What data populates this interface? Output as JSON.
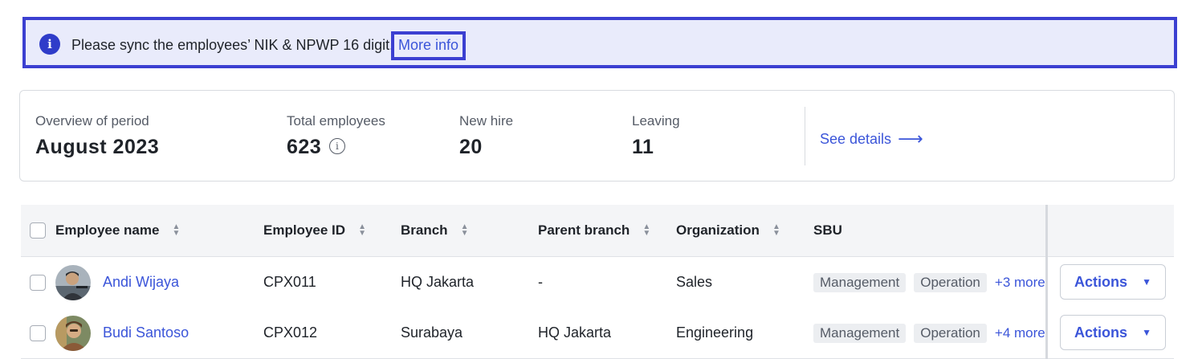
{
  "banner": {
    "icon": "info-icon",
    "message": "Please sync the employees’ NIK & NPWP 16 digit.",
    "link_label": "More info",
    "accent": "#3b3fd1",
    "background": "#e9ebfb"
  },
  "overview": {
    "period_label": "Overview of period",
    "period_value": "August 2023",
    "total_label": "Total employees",
    "total_value": "623",
    "new_hire_label": "New hire",
    "new_hire_value": "20",
    "leaving_label": "Leaving",
    "leaving_value": "11",
    "see_details_label": "See details",
    "arrow": "⟶"
  },
  "table": {
    "headers": {
      "name": "Employee name",
      "id": "Employee ID",
      "branch": "Branch",
      "parent_branch": "Parent branch",
      "organization": "Organization",
      "sbu": "SBU"
    },
    "rows": [
      {
        "name": "Andi Wijaya",
        "id": "CPX011",
        "branch": "HQ Jakarta",
        "parent_branch": "-",
        "organization": "Sales",
        "sbu_tags": [
          "Management",
          "Operation"
        ],
        "sbu_more": "+3 more",
        "actions_label": "Actions"
      },
      {
        "name": "Budi Santoso",
        "id": "CPX012",
        "branch": "Surabaya",
        "parent_branch": "HQ Jakarta",
        "organization": "Engineering",
        "sbu_tags": [
          "Management",
          "Operation"
        ],
        "sbu_more": "+4 more",
        "actions_label": "Actions"
      }
    ]
  }
}
